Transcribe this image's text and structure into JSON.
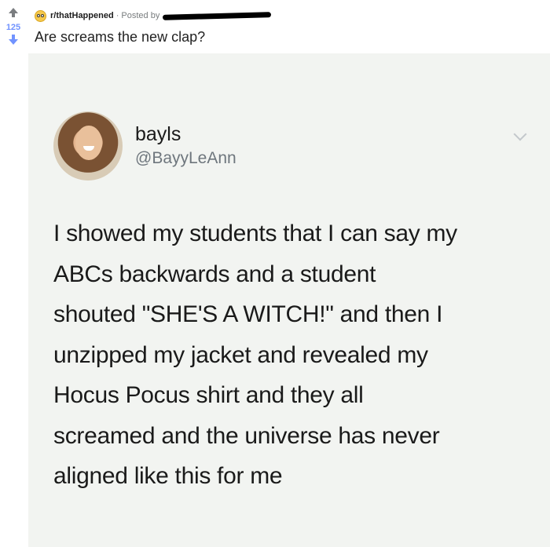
{
  "post": {
    "vote_count": "125",
    "subreddit": "r/thatHappened",
    "posted_by_label": "· Posted by",
    "title": "Are screams the new clap?"
  },
  "tweet": {
    "display_name": "bayls",
    "handle": "@BayyLeAnn",
    "text_lines": [
      "I showed my students that I can say my",
      "ABCs backwards and a student",
      "shouted \"SHE'S A WITCH!\" and then I",
      "unzipped my jacket and revealed my",
      "Hocus Pocus shirt and they all",
      "screamed and the universe has never",
      "aligned like this for me"
    ]
  },
  "colors": {
    "upvote_gray": "#7a7d80",
    "downvote_blue": "#7193ff",
    "image_bg": "#f2f4f1"
  },
  "icons": {
    "subreddit": "emoji-face-icon",
    "tweet_menu": "chevron-down-icon"
  }
}
